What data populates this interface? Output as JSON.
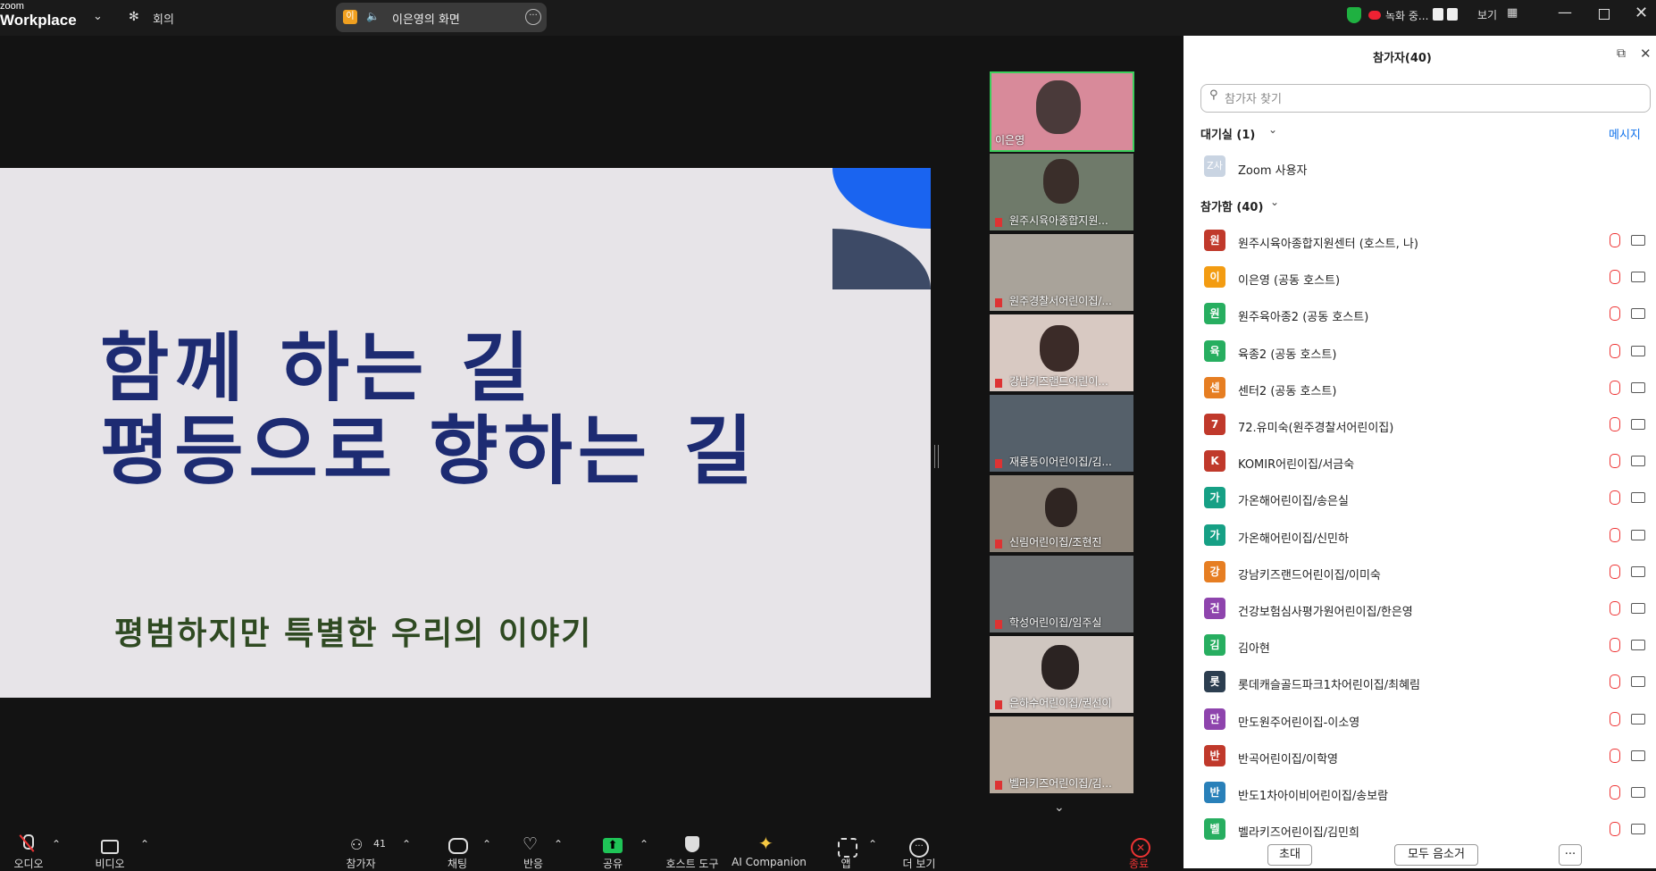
{
  "app": {
    "brand_top": "zoom",
    "brand_bottom": "Workplace",
    "meeting_tab": "회의"
  },
  "share_pill": {
    "avatar": "이",
    "label": "이은영의 화면"
  },
  "topbar": {
    "recording": "녹화 중...",
    "view": "보기"
  },
  "slide": {
    "line1": "함께 하는 길",
    "line2": "평등으로 향하는 길",
    "subtitle": "평범하지만  특별한 우리의 이야기"
  },
  "thumbnails": [
    {
      "name": "이은영"
    },
    {
      "name": "원주시육아종합지원..."
    },
    {
      "name": "원주경찰서어린이집/..."
    },
    {
      "name": "강남키즈랜드어린이..."
    },
    {
      "name": "재롱동이어린이집/김..."
    },
    {
      "name": "신림어린이집/조현진"
    },
    {
      "name": "학성어린이집/임주실"
    },
    {
      "name": "은하수어린이집/권선이"
    },
    {
      "name": "벨라키즈어린이집/김..."
    }
  ],
  "panel": {
    "title": "참가자(40)",
    "search_placeholder": "참가자 찾기",
    "waiting_header": "대기실 (1)",
    "message_link": "메시지",
    "waiting_user": {
      "avatar": "Z사",
      "name": "Zoom 사용자"
    },
    "joined_header": "참가함 (40)",
    "participants": [
      {
        "avatar": "원",
        "color": "#c0392b",
        "name": "원주시육아종합지원센터 (호스트, 나)"
      },
      {
        "avatar": "이",
        "color": "#f39c12",
        "name": "이은영 (공동 호스트)"
      },
      {
        "avatar": "원",
        "color": "#27ae60",
        "name": "원주육아종2 (공동 호스트)"
      },
      {
        "avatar": "육",
        "color": "#27ae60",
        "name": "육종2 (공동 호스트)"
      },
      {
        "avatar": "센",
        "color": "#e67e22",
        "name": "센터2 (공동 호스트)"
      },
      {
        "avatar": "7",
        "color": "#c0392b",
        "name": "72.유미숙(원주경찰서어린이집)"
      },
      {
        "avatar": "K",
        "color": "#c0392b",
        "name": "KOMIR어린이집/서금숙"
      },
      {
        "avatar": "가",
        "color": "#16a085",
        "name": "가온해어린이집/송은실"
      },
      {
        "avatar": "가",
        "color": "#16a085",
        "name": "가온해어린이집/신민하"
      },
      {
        "avatar": "강",
        "color": "#e67e22",
        "name": "강남키즈랜드어린이집/이미숙"
      },
      {
        "avatar": "건",
        "color": "#8e44ad",
        "name": "건강보험심사평가원어린이집/한은영"
      },
      {
        "avatar": "김",
        "color": "#27ae60",
        "name": "김아현"
      },
      {
        "avatar": "롯",
        "color": "#2c3e50",
        "name": "롯데캐슬골드파크1차어린이집/최혜림"
      },
      {
        "avatar": "만",
        "color": "#8e44ad",
        "name": "만도원주어린이집-이소영"
      },
      {
        "avatar": "반",
        "color": "#c0392b",
        "name": "반곡어린이집/이학영"
      },
      {
        "avatar": "반",
        "color": "#2980b9",
        "name": "반도1차아이비어린이집/송보람"
      },
      {
        "avatar": "벨",
        "color": "#27ae60",
        "name": "벨라키즈어린이집/김민희"
      }
    ],
    "invite_button": "초대",
    "mute_all_button": "모두 음소거",
    "more_button": "···"
  },
  "toolbar": {
    "audio": "오디오",
    "video": "비디오",
    "participants": "참가자",
    "participants_count": "41",
    "chat": "채팅",
    "react": "반응",
    "share": "공유",
    "host_tools": "호스트 도구",
    "ai": "AI Companion",
    "apps": "앱",
    "more": "더 보기",
    "end": "종료"
  }
}
